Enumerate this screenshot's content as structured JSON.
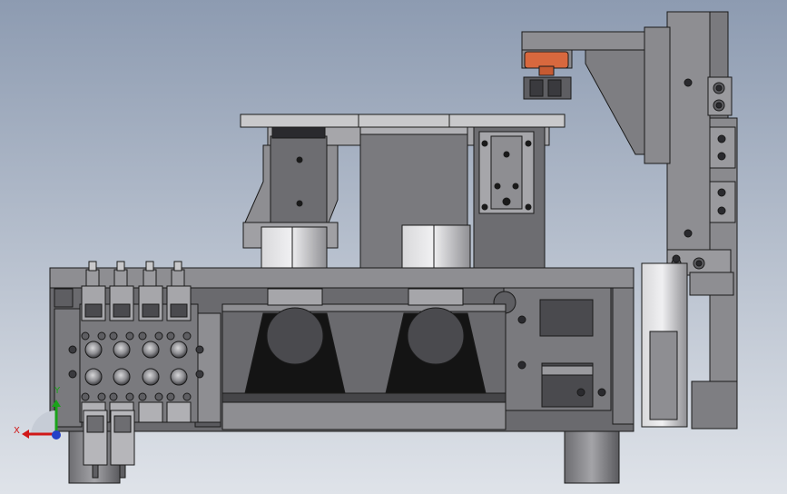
{
  "viewport": {
    "background_top": "#8d9bb1",
    "background_bottom": "#dfe3e9"
  },
  "colors": {
    "metal_light": "#c9c9cb",
    "metal_mid": "#8e8e92",
    "metal_dark": "#5e5e62",
    "edge": "#1a1a1a",
    "black_part": "#141414",
    "orange_part": "#d8683e",
    "dark_band": "#454548"
  },
  "triad": {
    "x_label": "X",
    "y_label": "Y",
    "x_color": "#d01818",
    "y_color": "#1aa31a",
    "z_color": "#2440c8"
  }
}
